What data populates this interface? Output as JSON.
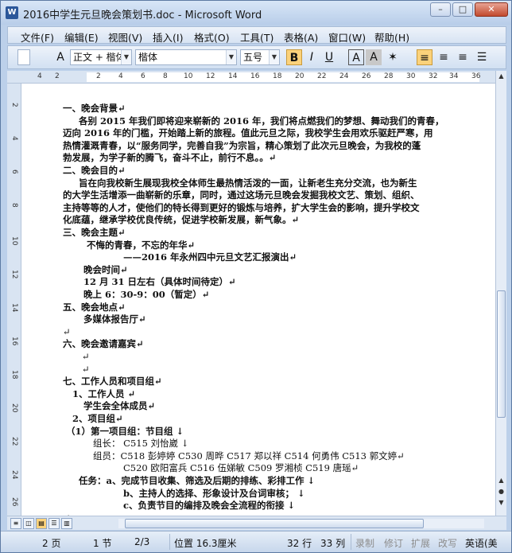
{
  "window": {
    "title": "2016中学生元旦晚会策划书.doc - Microsoft Word",
    "app_icon": "W",
    "controls": {
      "minimize": "–",
      "maximize": "□",
      "close": "✕"
    }
  },
  "menu": [
    "文件(F)",
    "编辑(E)",
    "视图(V)",
    "插入(I)",
    "格式(O)",
    "工具(T)",
    "表格(A)",
    "窗口(W)",
    "帮助(H)"
  ],
  "toolbar": {
    "style_value": "正文 + 楷体",
    "font_value": "楷体",
    "size_value": "五号",
    "bold": "B",
    "italic": "I",
    "underline": "U",
    "font_size_icon": "A",
    "char_border": "A",
    "style_a": "A"
  },
  "ruler": {
    "numbers": [
      "4",
      "2",
      "2",
      "4",
      "6",
      "8",
      "10",
      "12",
      "14",
      "16",
      "18",
      "20",
      "22",
      "24",
      "26",
      "28",
      "30",
      "32",
      "34",
      "36",
      "38"
    ],
    "left_numbers": [
      "2",
      "4",
      "6",
      "8",
      "10",
      "12",
      "14",
      "16",
      "18",
      "20",
      "22",
      "24",
      "26"
    ]
  },
  "document": {
    "lines": [
      {
        "text": "一、晚会背景↵",
        "indent": 72,
        "bold": true
      },
      {
        "text": "各别 2015 年我们即将迎来崭新的 2016 年，我们将点燃我们的梦想、舞动我们的青春，",
        "indent": 92,
        "bold": true
      },
      {
        "text": "迈向 2016 年的门槛，开始踏上新的旅程。值此元旦之际，我校学生会用欢乐驱赶严寒，用",
        "indent": 72,
        "bold": true
      },
      {
        "text": "热情灌溉青春，以“服务同学，完善自我”为宗旨，精心策划了此次元旦晚会，为我校的蓬",
        "indent": 72,
        "bold": true
      },
      {
        "text": "勃发展，为学子新的腾飞，奋斗不止，前行不息。。↵",
        "indent": 72,
        "bold": true
      },
      {
        "text": "二、晚会目的↵",
        "indent": 72,
        "bold": true
      },
      {
        "text": "旨在向我校新生展现我校全体师生最热情活泼的一面，让新老生充分交流，也为新生",
        "indent": 92,
        "bold": true
      },
      {
        "text": "的大学生活增添一曲崭新的乐章，同时，通过这场元旦晚会发掘我校文艺、策划、组织、",
        "indent": 72,
        "bold": true
      },
      {
        "text": "主持等等的人才，使他们的特长得到更好的锻炼与培养，扩大学生会的影响，提升学校文",
        "indent": 72,
        "bold": true
      },
      {
        "text": "化底蕴，继承学校优良传统，促进学校新发展，新气象。↵",
        "indent": 72,
        "bold": true
      },
      {
        "text": "三、晚会主题↵",
        "indent": 72,
        "bold": true
      },
      {
        "text": "不悔的青春，不忘的年华↵",
        "indent": 102,
        "bold": true
      },
      {
        "text": "——2016 年永州四中元旦文艺汇报演出↵",
        "indent": 148,
        "bold": true
      },
      {
        "text": "晚会时间↵",
        "indent": 98,
        "bold": true
      },
      {
        "text": "12 月 31 日左右（具体时间待定）↵",
        "indent": 98,
        "bold": true
      },
      {
        "text": "晚上 6：30-9：00（暂定）↵",
        "indent": 98,
        "bold": true
      },
      {
        "text": "五、晚会地点↵",
        "indent": 72,
        "bold": true
      },
      {
        "text": "多媒体报告厅↵",
        "indent": 98,
        "bold": true
      },
      {
        "text": "↵",
        "indent": 72,
        "bold": false
      },
      {
        "text": "六、晚会邀请嘉宾↵",
        "indent": 72,
        "bold": true
      },
      {
        "text": "↵",
        "indent": 96,
        "bold": false
      },
      {
        "text": "↵",
        "indent": 96,
        "bold": false
      },
      {
        "text": "七、工作人员和项目组↵",
        "indent": 72,
        "bold": true
      },
      {
        "text": "1、工作人员 ↵",
        "indent": 84,
        "bold": true
      },
      {
        "text": "学生会全体成员↵",
        "indent": 98,
        "bold": true
      },
      {
        "text": "2、项目组↵",
        "indent": 84,
        "bold": true
      },
      {
        "text": "（1）第一项目组：节目组 ↓",
        "indent": 76,
        "bold": true
      },
      {
        "text": "组长：  C515 刘怡崴 ↓",
        "indent": 110,
        "bold": false
      },
      {
        "text": "组员：C518 彭婷婷    C530 周晔    C517 郑以祥     C514 何勇伟    C513 郭文婷↵",
        "indent": 110,
        "bold": false
      },
      {
        "text": "C520 欧阳富兵    C516 伍娣敏    C509 罗湘桢 C519 唐瑶↵",
        "indent": 148,
        "bold": false
      },
      {
        "text": "任务：a、完成节目收集、筛选及后期的排练、彩排工作 ↓",
        "indent": 92,
        "bold": true
      },
      {
        "text": "b、主持人的选择、形象设计及台词审核；  ↓",
        "indent": 148,
        "bold": true
      },
      {
        "text": "c、负责节目的编排及晚会全流程的衔接 ↓",
        "indent": 148,
        "bold": true
      },
      {
        "text": "↵",
        "indent": 72,
        "bold": false
      }
    ]
  },
  "statusbar": {
    "page": "2 页",
    "section": "1 节",
    "page_of": "2/3",
    "position": "位置 16.3厘米",
    "row": "32 行",
    "col": "33 列",
    "rec": "录制",
    "trk": "修订",
    "ext": "扩展",
    "ovr": "改写",
    "lang": "英语(美"
  }
}
